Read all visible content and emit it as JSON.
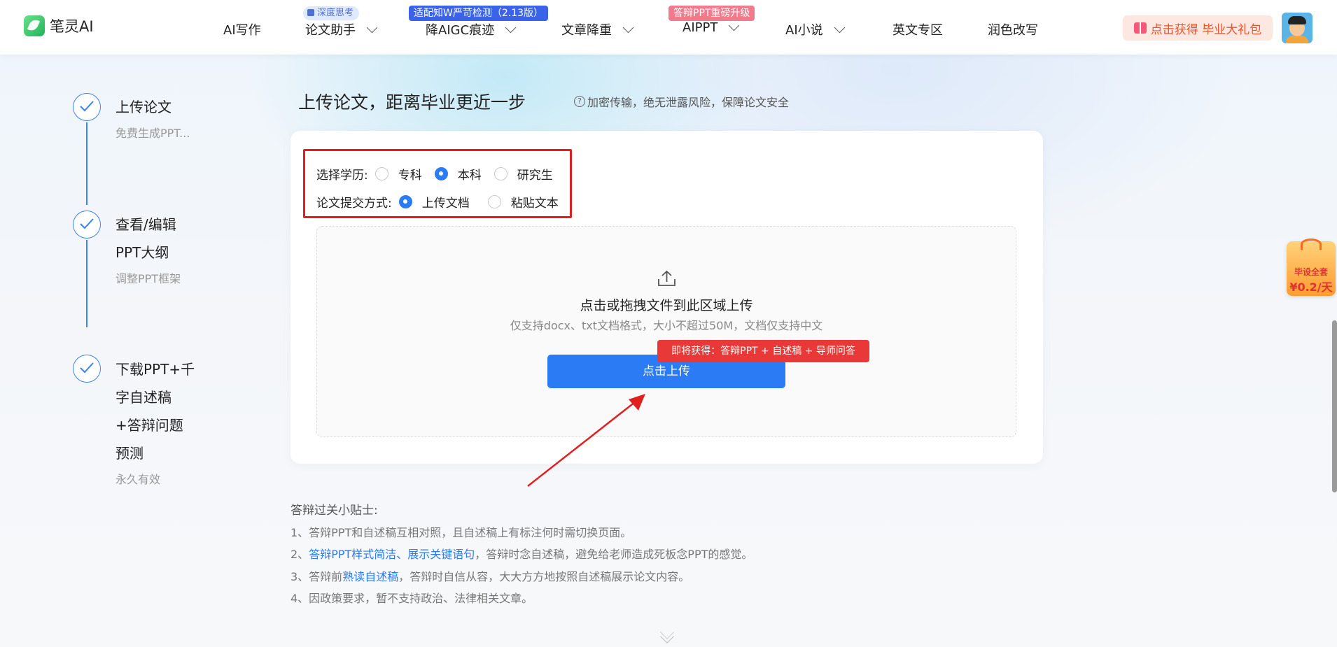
{
  "brand": {
    "name": "笔灵AI"
  },
  "nav": {
    "items": [
      {
        "label": "AI写作"
      },
      {
        "label": "论文助手"
      },
      {
        "label": "降AIGC痕迹"
      },
      {
        "label": "文章降重"
      },
      {
        "label": "AIPPT"
      },
      {
        "label": "AI小说"
      },
      {
        "label": "英文专区"
      },
      {
        "label": "润色改写"
      }
    ],
    "tags": {
      "deep_think": "深度思考",
      "aigc": "适配知W严苛检测（2.13版）",
      "ppt": "答辩PPT重磅升级"
    },
    "gift_label": "点击获得 毕业大礼包"
  },
  "steps": [
    {
      "title": "上传论文",
      "sub": "免费生成PPT..."
    },
    {
      "title_lines": [
        "查看/编辑",
        "PPT大纲"
      ],
      "sub": "调整PPT框架"
    },
    {
      "title_lines": [
        "下载PPT+千",
        "字自述稿",
        "+答辩问题",
        "预测"
      ],
      "sub": "永久有效"
    }
  ],
  "main": {
    "title": "上传论文，距离毕业更近一步",
    "notice": "加密传输，绝无泄露风险，保障论文安全",
    "education": {
      "label": "选择学历:",
      "options": [
        "专科",
        "本科",
        "研究生"
      ],
      "selected": "本科"
    },
    "submit_mode": {
      "label": "论文提交方式:",
      "options": [
        "上传文档",
        "粘贴文本"
      ],
      "selected": "上传文档"
    },
    "upload": {
      "title": "点击或拖拽文件到此区域上传",
      "hint": "仅支持docx、txt文档格式，大小不超过50M，文档仅支持中文",
      "button": "点击上传",
      "bubble": "即将获得：答辩PPT + 自述稿 + 导师问答"
    }
  },
  "tips": {
    "title": "答辩过关小贴士:",
    "t1": "1、答辩PPT和自述稿互相对照，且自述稿上有标注何时需切换页面。",
    "t2_pre": "2、",
    "t2_hl1": "答辩PPT样式简洁",
    "t2_sep": "、",
    "t2_hl2": "展示关键语句",
    "t2_post": "，答辩时念自述稿，避免给老师造成死板念PPT的感觉。",
    "t3_pre": "3、答辩前",
    "t3_hl": "熟读自述稿",
    "t3_post": "，答辩时自信从容，大大方方地按照自述稿展示论文内容。",
    "t4": "4、因政策要求，暂不支持政治、法律相关文章。"
  },
  "floater": {
    "line1": "毕设全套",
    "line2": "¥0.2/天"
  },
  "colors": {
    "primary": "#2b7bf5",
    "highlight_box": "#e02020",
    "bubble": "#e83838"
  }
}
